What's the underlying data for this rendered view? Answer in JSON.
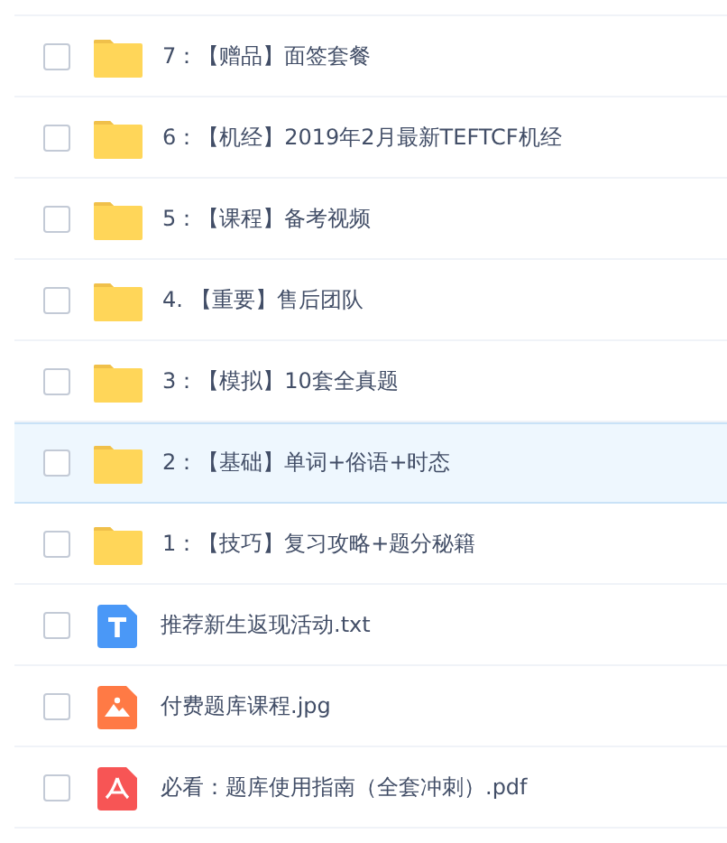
{
  "files": [
    {
      "kind": "folder",
      "name": "7：【赠品】面签套餐",
      "checked": false,
      "selected": false
    },
    {
      "kind": "folder",
      "name": "6：【机经】2019年2月最新TEFTCF机经",
      "checked": false,
      "selected": false
    },
    {
      "kind": "folder",
      "name": "5：【课程】备考视频",
      "checked": false,
      "selected": false
    },
    {
      "kind": "folder",
      "name": "4. 【重要】售后团队",
      "checked": false,
      "selected": false
    },
    {
      "kind": "folder",
      "name": "3：【模拟】10套全真题",
      "checked": false,
      "selected": false
    },
    {
      "kind": "folder",
      "name": "2：【基础】单词+俗语+时态",
      "checked": false,
      "selected": true
    },
    {
      "kind": "folder",
      "name": "1：【技巧】复习攻略+题分秘籍",
      "checked": false,
      "selected": false
    },
    {
      "kind": "text",
      "name": "推荐新生返现活动.txt",
      "checked": false,
      "selected": false
    },
    {
      "kind": "image",
      "name": "付费题库课程.jpg",
      "checked": false,
      "selected": false
    },
    {
      "kind": "pdf",
      "name": "必看：题库使用指南（全套冲刺）.pdf",
      "checked": false,
      "selected": false
    }
  ]
}
